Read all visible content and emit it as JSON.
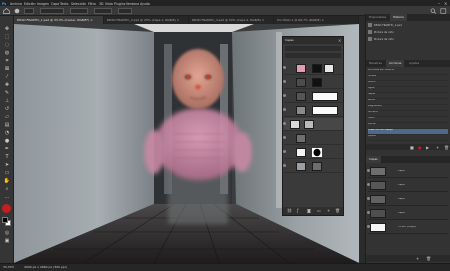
{
  "menubar": {
    "items": [
      "Ps",
      "Archivo",
      "Edición",
      "Imagen",
      "Capa",
      "Texto",
      "Selección",
      "Filtro",
      "3D",
      "Vista",
      "Plugins",
      "Ventana",
      "Ayuda"
    ]
  },
  "tabs": [
    {
      "label": "DEAD FRANTIC_1.psd @ 33,3% (Cooler, RGB/8*) ×",
      "active": true
    },
    {
      "label": "DEAD FRANTIC_2.psd @ 25% (Capa 1, RGB/8) ×",
      "active": false
    },
    {
      "label": "DEAD FRANTIC_3.psd @ 50% (Capa 2, RGB/8) ×",
      "active": false
    },
    {
      "label": "Sin título-1 @ 66,7% (RGB/8) ×",
      "active": false
    }
  ],
  "status": {
    "zoom": "33,33%",
    "doc": "4000 px x 2660 px (300 ppi)"
  },
  "layers_panel": {
    "title": "Capas"
  },
  "right_dock": {
    "top_tabs": [
      "Propiedades",
      "Historia"
    ],
    "history_items": [
      "DEAD FRANTIC_1.psd",
      "Pintura de niño",
      "Pintura de niño"
    ],
    "mid_tabs": [
      "Muestras",
      "Acciones",
      "Ajustes"
    ],
    "action_items": [
      "Acciones por defecto",
      "Viñeta",
      "Marco",
      "Agua",
      "Sepia",
      "Ruido",
      "Degradado",
      "Sombra",
      "Texto",
      "Borde",
      "Crear Acción Espejo",
      "Ajuste"
    ],
    "bottom_tab": "Capas",
    "bottom_items": [
      {
        "name": "Capa"
      },
      {
        "name": "Capa"
      },
      {
        "name": "Capa"
      },
      {
        "name": "Capa"
      },
      {
        "name": "Fondo (copia)"
      }
    ]
  },
  "colors": {
    "selection_blue": "#4d6a8c",
    "app_bg": "#2b2b2b"
  }
}
